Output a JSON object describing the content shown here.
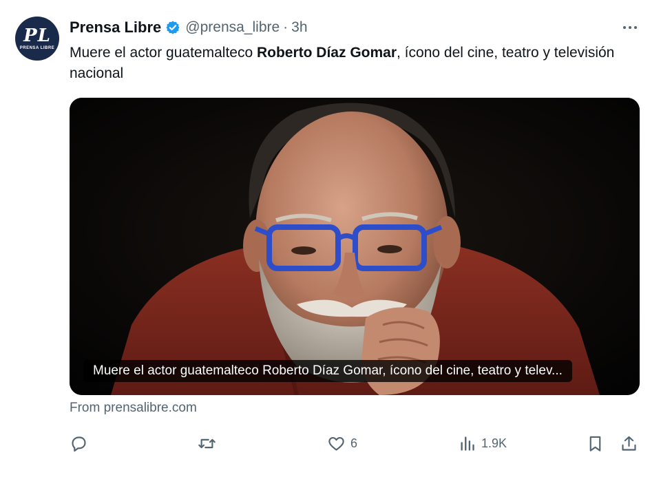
{
  "account": {
    "avatar_monogram": "PL",
    "avatar_small_text": "PRENSA LIBRE",
    "name": "Prensa Libre",
    "handle": "@prensa_libre",
    "separator": "·",
    "time": "3h"
  },
  "tweet": {
    "text_before": "Muere el actor guatemalteco ",
    "text_bold": "Roberto Díaz Gomar",
    "text_after": ", ícono del cine, teatro y televisión nacional"
  },
  "card": {
    "caption": "Muere el actor guatemalteco Roberto Díaz Gomar, ícono del cine, teatro y telev...",
    "source": "From prensalibre.com"
  },
  "actions": {
    "reply_count": "",
    "retweet_count": "",
    "like_count": "6",
    "views_count": "1.9K"
  },
  "colors": {
    "verified": "#1d9bf0",
    "muted": "#536471",
    "avatar_bg": "#1a2a4a"
  },
  "icons": [
    "verified-badge-icon",
    "more-options-icon",
    "reply-icon",
    "retweet-icon",
    "like-icon",
    "views-icon",
    "bookmark-icon",
    "share-icon"
  ]
}
